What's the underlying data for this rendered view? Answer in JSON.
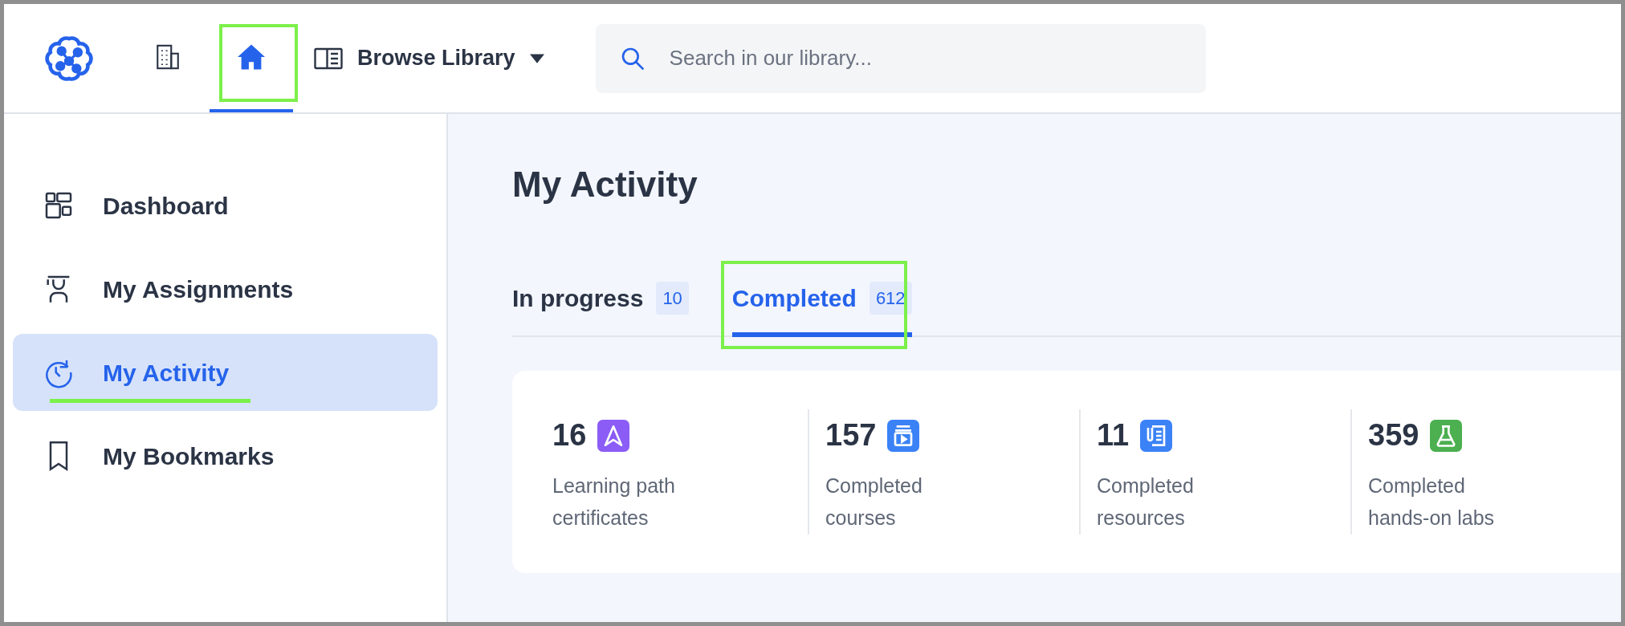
{
  "topbar": {
    "nav_icons": [
      {
        "kind": "building",
        "selected": false,
        "highlighted": false
      },
      {
        "kind": "home",
        "selected": true,
        "highlighted": true
      }
    ],
    "browse": {
      "label": "Browse Library"
    },
    "search": {
      "placeholder": "Search in our library..."
    }
  },
  "sidebar": {
    "items": [
      {
        "kind": "dashboard",
        "label": "Dashboard",
        "selected": false,
        "highlighted": false
      },
      {
        "kind": "assignments",
        "label": "My Assignments",
        "selected": false,
        "highlighted": false
      },
      {
        "kind": "activity",
        "label": "My Activity",
        "selected": true,
        "highlighted": true
      },
      {
        "kind": "bookmarks",
        "label": "My Bookmarks",
        "selected": false,
        "highlighted": false
      }
    ]
  },
  "main": {
    "title": "My Activity",
    "tabs": [
      {
        "label": "In progress",
        "count": "10",
        "selected": false,
        "highlighted": false
      },
      {
        "label": "Completed",
        "count": "612",
        "selected": true,
        "highlighted": true
      }
    ],
    "stats": [
      {
        "kind": "path",
        "value": "16",
        "label": "Learning path certificates",
        "color": "#8b5cf6"
      },
      {
        "kind": "course",
        "value": "157",
        "label": "Completed courses",
        "color": "#3b82f6"
      },
      {
        "kind": "resource",
        "value": "11",
        "label": "Completed resources",
        "color": "#3b82f6"
      },
      {
        "kind": "lab",
        "value": "359",
        "label": "Completed hands-on labs",
        "color": "#4caf50"
      }
    ]
  }
}
